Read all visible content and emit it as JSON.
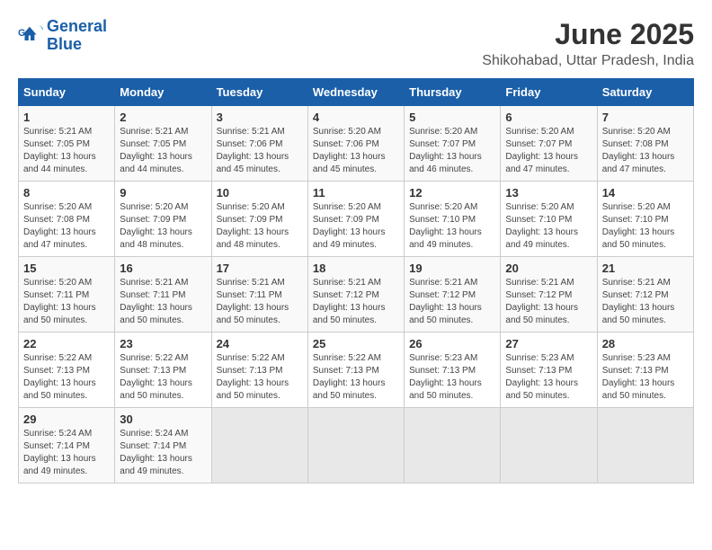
{
  "header": {
    "logo_line1": "General",
    "logo_line2": "Blue",
    "title": "June 2025",
    "subtitle": "Shikohabad, Uttar Pradesh, India"
  },
  "days_of_week": [
    "Sunday",
    "Monday",
    "Tuesday",
    "Wednesday",
    "Thursday",
    "Friday",
    "Saturday"
  ],
  "weeks": [
    [
      {
        "num": "1",
        "rise": "5:21 AM",
        "set": "7:05 PM",
        "daylight": "13 hours and 44 minutes."
      },
      {
        "num": "2",
        "rise": "5:21 AM",
        "set": "7:05 PM",
        "daylight": "13 hours and 44 minutes."
      },
      {
        "num": "3",
        "rise": "5:21 AM",
        "set": "7:06 PM",
        "daylight": "13 hours and 45 minutes."
      },
      {
        "num": "4",
        "rise": "5:20 AM",
        "set": "7:06 PM",
        "daylight": "13 hours and 45 minutes."
      },
      {
        "num": "5",
        "rise": "5:20 AM",
        "set": "7:07 PM",
        "daylight": "13 hours and 46 minutes."
      },
      {
        "num": "6",
        "rise": "5:20 AM",
        "set": "7:07 PM",
        "daylight": "13 hours and 47 minutes."
      },
      {
        "num": "7",
        "rise": "5:20 AM",
        "set": "7:08 PM",
        "daylight": "13 hours and 47 minutes."
      }
    ],
    [
      {
        "num": "8",
        "rise": "5:20 AM",
        "set": "7:08 PM",
        "daylight": "13 hours and 47 minutes."
      },
      {
        "num": "9",
        "rise": "5:20 AM",
        "set": "7:09 PM",
        "daylight": "13 hours and 48 minutes."
      },
      {
        "num": "10",
        "rise": "5:20 AM",
        "set": "7:09 PM",
        "daylight": "13 hours and 48 minutes."
      },
      {
        "num": "11",
        "rise": "5:20 AM",
        "set": "7:09 PM",
        "daylight": "13 hours and 49 minutes."
      },
      {
        "num": "12",
        "rise": "5:20 AM",
        "set": "7:10 PM",
        "daylight": "13 hours and 49 minutes."
      },
      {
        "num": "13",
        "rise": "5:20 AM",
        "set": "7:10 PM",
        "daylight": "13 hours and 49 minutes."
      },
      {
        "num": "14",
        "rise": "5:20 AM",
        "set": "7:10 PM",
        "daylight": "13 hours and 50 minutes."
      }
    ],
    [
      {
        "num": "15",
        "rise": "5:20 AM",
        "set": "7:11 PM",
        "daylight": "13 hours and 50 minutes."
      },
      {
        "num": "16",
        "rise": "5:21 AM",
        "set": "7:11 PM",
        "daylight": "13 hours and 50 minutes."
      },
      {
        "num": "17",
        "rise": "5:21 AM",
        "set": "7:11 PM",
        "daylight": "13 hours and 50 minutes."
      },
      {
        "num": "18",
        "rise": "5:21 AM",
        "set": "7:12 PM",
        "daylight": "13 hours and 50 minutes."
      },
      {
        "num": "19",
        "rise": "5:21 AM",
        "set": "7:12 PM",
        "daylight": "13 hours and 50 minutes."
      },
      {
        "num": "20",
        "rise": "5:21 AM",
        "set": "7:12 PM",
        "daylight": "13 hours and 50 minutes."
      },
      {
        "num": "21",
        "rise": "5:21 AM",
        "set": "7:12 PM",
        "daylight": "13 hours and 50 minutes."
      }
    ],
    [
      {
        "num": "22",
        "rise": "5:22 AM",
        "set": "7:13 PM",
        "daylight": "13 hours and 50 minutes."
      },
      {
        "num": "23",
        "rise": "5:22 AM",
        "set": "7:13 PM",
        "daylight": "13 hours and 50 minutes."
      },
      {
        "num": "24",
        "rise": "5:22 AM",
        "set": "7:13 PM",
        "daylight": "13 hours and 50 minutes."
      },
      {
        "num": "25",
        "rise": "5:22 AM",
        "set": "7:13 PM",
        "daylight": "13 hours and 50 minutes."
      },
      {
        "num": "26",
        "rise": "5:23 AM",
        "set": "7:13 PM",
        "daylight": "13 hours and 50 minutes."
      },
      {
        "num": "27",
        "rise": "5:23 AM",
        "set": "7:13 PM",
        "daylight": "13 hours and 50 minutes."
      },
      {
        "num": "28",
        "rise": "5:23 AM",
        "set": "7:13 PM",
        "daylight": "13 hours and 50 minutes."
      }
    ],
    [
      {
        "num": "29",
        "rise": "5:24 AM",
        "set": "7:14 PM",
        "daylight": "13 hours and 49 minutes."
      },
      {
        "num": "30",
        "rise": "5:24 AM",
        "set": "7:14 PM",
        "daylight": "13 hours and 49 minutes."
      },
      null,
      null,
      null,
      null,
      null
    ]
  ]
}
